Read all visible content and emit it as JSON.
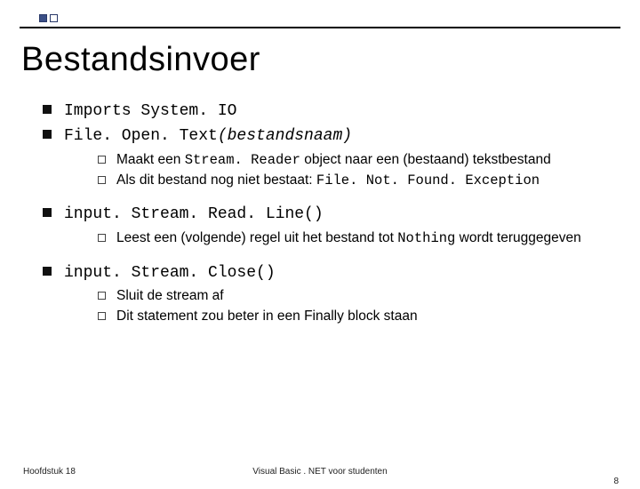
{
  "title": "Bestandsinvoer",
  "bullets": [
    {
      "segments": [
        {
          "text": "Imports System. IO",
          "cls": "code"
        }
      ],
      "sub": []
    },
    {
      "segments": [
        {
          "text": "File. Open. Text",
          "cls": "code"
        },
        {
          "text": "(bestandsnaam)",
          "cls": "code italic"
        }
      ],
      "sub": [
        {
          "segments": [
            {
              "text": "Maakt een ",
              "cls": ""
            },
            {
              "text": "Stream. Reader",
              "cls": "code"
            },
            {
              "text": " object naar een (bestaand) tekstbestand",
              "cls": ""
            }
          ]
        },
        {
          "segments": [
            {
              "text": "Als dit bestand nog niet bestaat: ",
              "cls": ""
            },
            {
              "text": "File. Not. Found. Exception",
              "cls": "code"
            }
          ]
        }
      ]
    },
    {
      "segments": [
        {
          "text": "input. Stream. Read. Line()",
          "cls": "code"
        }
      ],
      "sub": [
        {
          "segments": [
            {
              "text": "Leest een (volgende) regel uit het bestand tot ",
              "cls": ""
            },
            {
              "text": "Nothing",
              "cls": "code"
            },
            {
              "text": " wordt teruggegeven",
              "cls": ""
            }
          ]
        }
      ]
    },
    {
      "segments": [
        {
          "text": "input. Stream. Close()",
          "cls": "code"
        }
      ],
      "sub": [
        {
          "segments": [
            {
              "text": "Sluit de stream af",
              "cls": ""
            }
          ]
        },
        {
          "segments": [
            {
              "text": "Dit statement zou beter in een Finally block staan",
              "cls": ""
            }
          ]
        }
      ]
    }
  ],
  "footer": {
    "left": "Hoofdstuk 18",
    "center": "Visual Basic . NET voor studenten",
    "right": "8"
  }
}
